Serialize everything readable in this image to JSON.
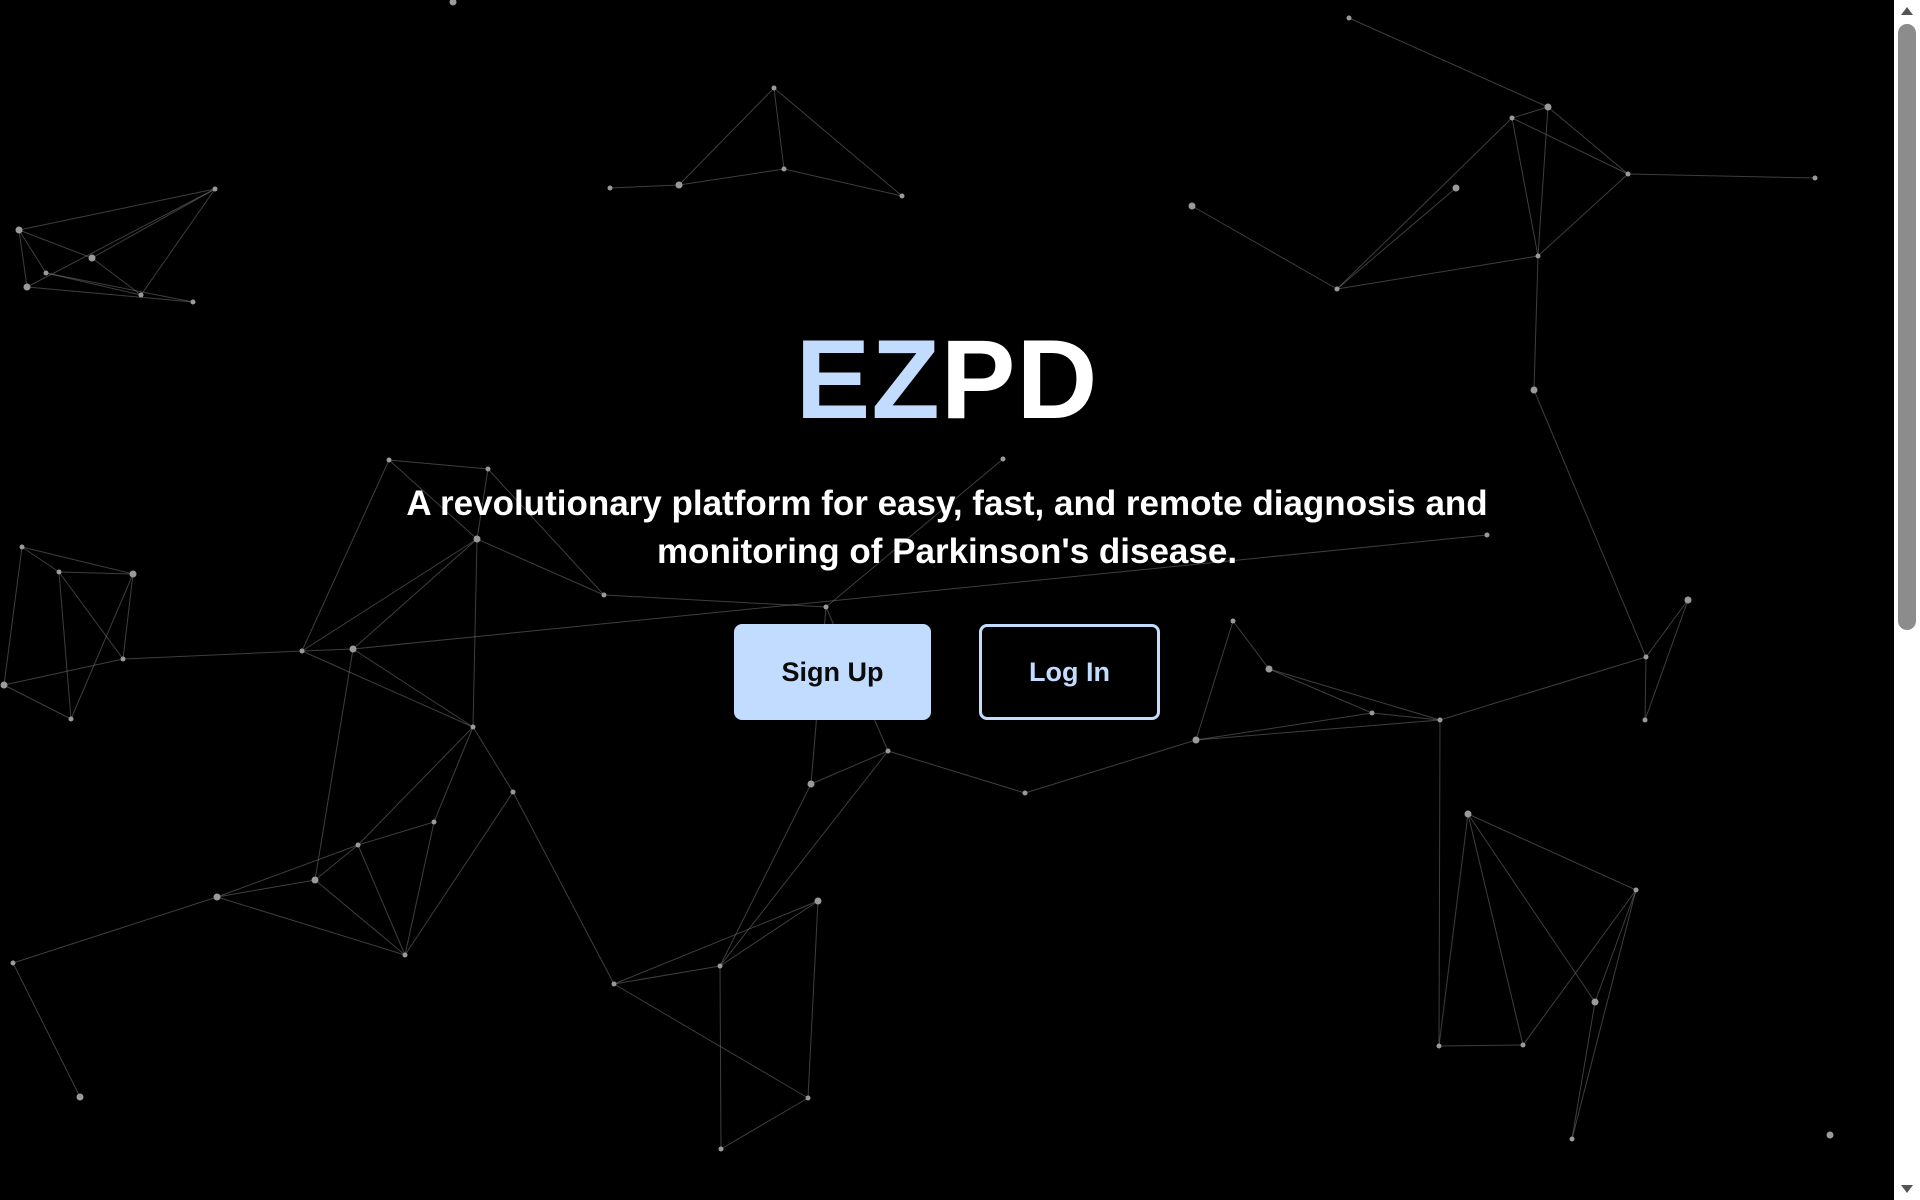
{
  "brand": {
    "accent_text": "EZ",
    "main_text": "PD",
    "accent_color": "#c2dcff",
    "main_color": "#ffffff"
  },
  "tagline": "A revolutionary platform for easy, fast, and remote diagnosis and monitoring of Parkinson's disease.",
  "actions": {
    "signup_label": "Sign Up",
    "login_label": "Log In"
  },
  "colors": {
    "background": "#000000",
    "primary": "#c2dcff",
    "network": "#8a8a8a"
  },
  "scrollbar": {
    "up_icon": "chevron-up-icon",
    "down_icon": "chevron-down-icon"
  }
}
